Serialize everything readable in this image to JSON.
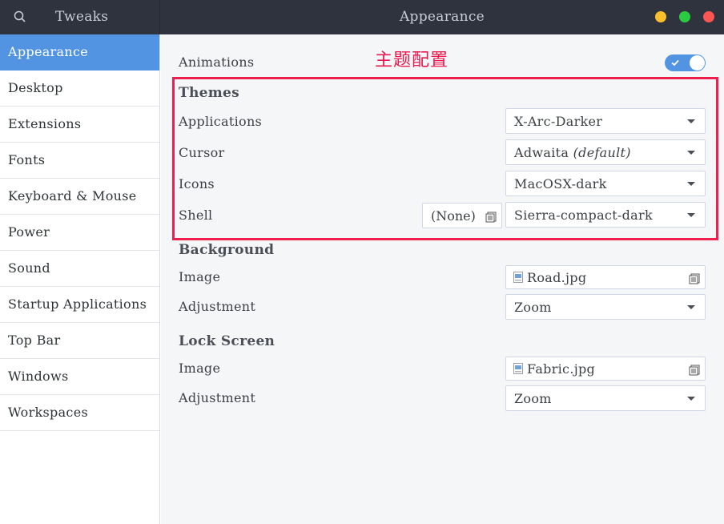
{
  "header": {
    "app_title": "Tweaks",
    "window_title": "Appearance",
    "colors": {
      "bar": "#2f333d",
      "minimize": "#fdbe2e",
      "maximize": "#2bca41",
      "close": "#fc5654"
    }
  },
  "sidebar": {
    "items": [
      {
        "label": "Appearance",
        "active": true
      },
      {
        "label": "Desktop"
      },
      {
        "label": "Extensions"
      },
      {
        "label": "Fonts"
      },
      {
        "label": "Keyboard & Mouse"
      },
      {
        "label": "Power"
      },
      {
        "label": "Sound"
      },
      {
        "label": "Startup Applications"
      },
      {
        "label": "Top Bar"
      },
      {
        "label": "Windows"
      },
      {
        "label": "Workspaces"
      }
    ],
    "accent": "#5294e2"
  },
  "main": {
    "annotation": "主题配置",
    "animations": {
      "label": "Animations",
      "enabled": true
    },
    "themes": {
      "heading": "Themes",
      "applications": {
        "label": "Applications",
        "value": "X-Arc-Darker"
      },
      "cursor": {
        "label": "Cursor",
        "value": "Adwaita",
        "value_suffix": "(default)"
      },
      "icons": {
        "label": "Icons",
        "value": "MacOSX-dark"
      },
      "shell": {
        "label": "Shell",
        "file_value": "(None)",
        "value": "Sierra-compact-dark"
      }
    },
    "background": {
      "heading": "Background",
      "image": {
        "label": "Image",
        "value": "Road.jpg"
      },
      "adjustment": {
        "label": "Adjustment",
        "value": "Zoom"
      }
    },
    "lock_screen": {
      "heading": "Lock Screen",
      "image": {
        "label": "Image",
        "value": "Fabric.jpg"
      },
      "adjustment": {
        "label": "Adjustment",
        "value": "Zoom"
      }
    }
  }
}
